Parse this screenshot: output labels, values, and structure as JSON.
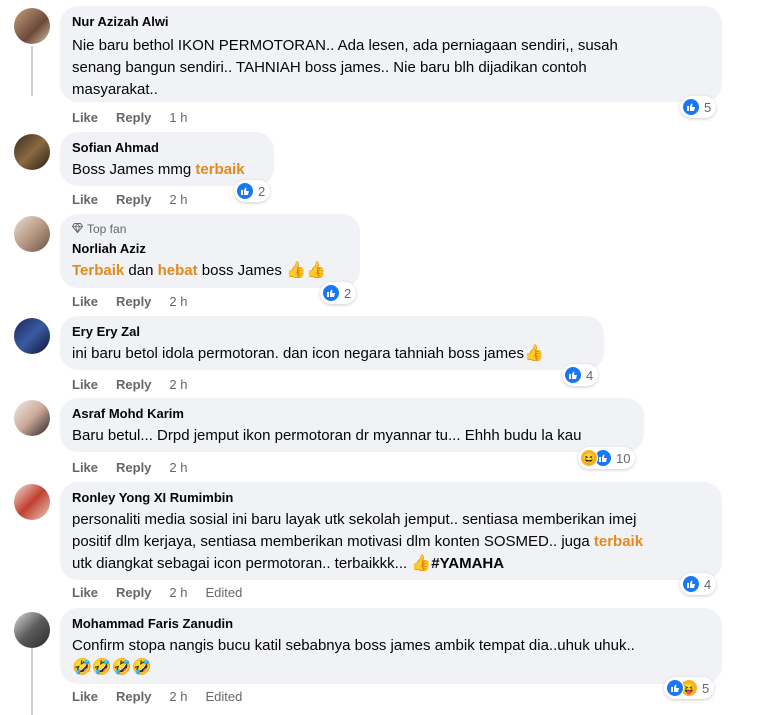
{
  "comments": [
    {
      "name": "Nur Azizah Alwi",
      "lines": [
        "Nie baru bethol IKON PERMOTORAN.. Ada lesen, ada perniagaan sendiri,, susah",
        "senang bangun sendiri.. TAHNIAH boss james.. Nie baru blh dijadikan contoh",
        "masyarakat.."
      ],
      "like": "Like",
      "reply": "Reply",
      "time": "1 h",
      "reactions": "5"
    },
    {
      "name": "Sofian Ahmad",
      "text_pre": "Boss James mmg ",
      "text_hl": "terbaik",
      "like": "Like",
      "reply": "Reply",
      "time": "2 h",
      "reactions": "2"
    },
    {
      "badge": "Top fan",
      "name": "Norliah Aziz",
      "hl1": "Terbaik",
      "mid": " dan ",
      "hl2": "hebat",
      "post": " boss James ",
      "emoji": "👍👍",
      "like": "Like",
      "reply": "Reply",
      "time": "2 h",
      "reactions": "2"
    },
    {
      "name": "Ery Ery Zal",
      "text": "ini baru betol idola permotoran. dan icon negara tahniah boss james",
      "emoji": "👍",
      "like": "Like",
      "reply": "Reply",
      "time": "2 h",
      "reactions": "4"
    },
    {
      "name": "Asraf Mohd Karim",
      "text": "Baru betul... Drpd jemput ikon permotoran dr myannar tu... Ehhh budu la kau",
      "like": "Like",
      "reply": "Reply",
      "time": "2 h",
      "reactions": "10"
    },
    {
      "name": "Ronley Yong XI Rumimbin",
      "line1": "personaliti media sosial ini baru layak utk sekolah jemput.. sentiasa memberikan imej",
      "line2_pre": "positif dlm kerjaya, sentiasa memberikan motivasi dlm konten SOSMED.. juga ",
      "line2_hl": "terbaik",
      "line3_pre": "utk diangkat sebagai icon permotoran.. terbaikkk... ",
      "line3_emoji": "👍",
      "line3_tag": "#YAMAHA",
      "like": "Like",
      "reply": "Reply",
      "time": "2 h",
      "edited": "Edited",
      "reactions": "4"
    },
    {
      "name": "Mohammad Faris Zanudin",
      "line1": "Confirm stopa nangis bucu katil sebabnya boss james ambik tempat dia..uhuk uhuk..",
      "emoji": "🤣🤣🤣🤣",
      "like": "Like",
      "reply": "Reply",
      "time": "2 h",
      "edited": "Edited",
      "reactions": "5"
    }
  ],
  "colors": {
    "highlight": "#e38a1c",
    "like_blue": "#1877f2",
    "bubble": "#f0f2f5",
    "meta": "#65676b"
  }
}
